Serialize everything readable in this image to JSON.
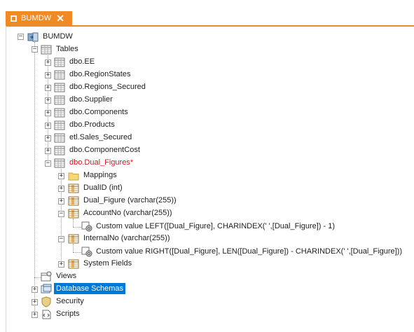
{
  "tab": {
    "title": "BUMDW",
    "close_glyph": "✕"
  },
  "tree": {
    "root": {
      "label": "BUMDW",
      "icon": "database-icon"
    },
    "tables": {
      "label": "Tables",
      "items": [
        {
          "label": "dbo.EE"
        },
        {
          "label": "dbo.RegionStates"
        },
        {
          "label": "dbo.Regions_Secured"
        },
        {
          "label": "dbo.Supplier"
        },
        {
          "label": "dbo.Components"
        },
        {
          "label": "dbo.Products"
        },
        {
          "label": "etl.Sales_Secured"
        },
        {
          "label": "dbo.ComponentCost"
        },
        {
          "label": "dbo.Dual_Figures*",
          "modified": true
        }
      ],
      "dual_children": {
        "mappings": "Mappings",
        "dual_id": "DualID (int)",
        "dual_figure": "Dual_Figure (varchar(255))",
        "account_no": "AccountNo (varchar(255))",
        "account_custom": "Custom value LEFT([Dual_Figure], CHARINDEX(' ',[Dual_Figure]) - 1)",
        "internal_no": "InternalNo (varchar(255))",
        "internal_custom": "Custom value RIGHT([Dual_Figure], LEN([Dual_Figure]) - CHARINDEX(' ',[Dual_Figure]))",
        "system_fields": "System Fields"
      }
    },
    "views": {
      "label": "Views"
    },
    "schemas": {
      "label": "Database Schemas",
      "selected": true
    },
    "security": {
      "label": "Security"
    },
    "scripts": {
      "label": "Scripts"
    }
  },
  "colors": {
    "accent": "#f08a24",
    "selection": "#0078d7",
    "modified_text": "#d4161b"
  }
}
